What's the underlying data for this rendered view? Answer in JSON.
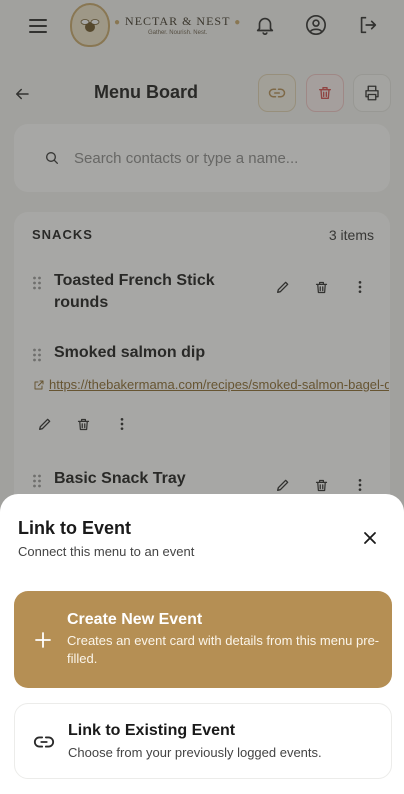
{
  "brand": {
    "name": "NECTAR & NEST",
    "tagline": "Gather. Nourish. Nest."
  },
  "page": {
    "title": "Menu Board"
  },
  "search": {
    "placeholder": "Search contacts or type a name..."
  },
  "section": {
    "title": "SNACKS",
    "count": "3 items",
    "items": [
      {
        "name_line1": "Toasted French Stick",
        "name_line2": "rounds"
      },
      {
        "name_line1": "Smoked salmon dip",
        "link": "https://thebakermama.com/recipes/smoked-salmon-bagel-dip/"
      },
      {
        "name_line1": "Basic Snack Tray"
      }
    ]
  },
  "sheet": {
    "title": "Link to Event",
    "subtitle": "Connect this menu to an event",
    "create": {
      "title": "Create New Event",
      "description": "Creates an event card with details from this menu pre-filled."
    },
    "link_existing": {
      "title": "Link to Existing Event",
      "description": "Choose from your previously logged events."
    }
  },
  "colors": {
    "accent": "#b58f54",
    "danger": "#d64b4b",
    "link": "#8a6a2f"
  }
}
